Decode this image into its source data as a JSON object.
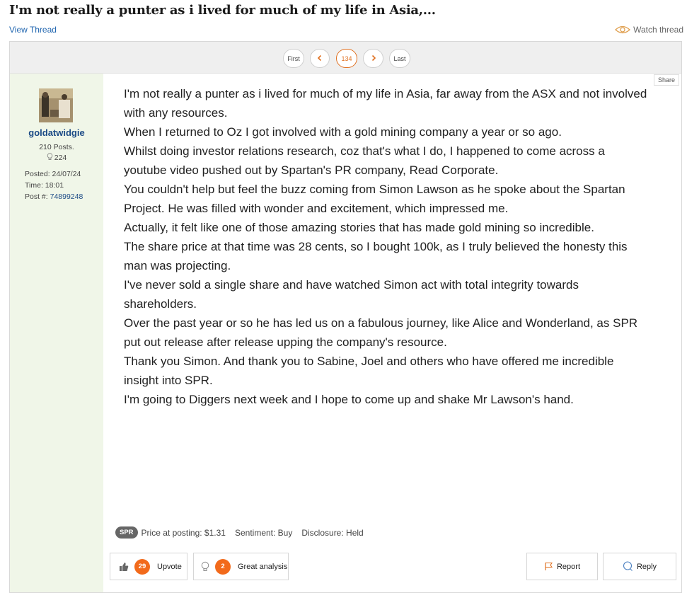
{
  "thread": {
    "title": "I'm not really a punter as i lived for much of my life in Asia,...",
    "view_thread_label": "View Thread",
    "watch_label": "Watch thread"
  },
  "pager": {
    "first": "First",
    "current": "134",
    "last": "Last"
  },
  "author": {
    "username": "goldatwidgie",
    "posts": "210 Posts.",
    "likes": "224",
    "posted": "Posted: 24/07/24",
    "time": "Time: 18:01",
    "post_label": "Post #:",
    "post_number": "74899248"
  },
  "share_label": "Share",
  "post": {
    "lines": [
      "I'm not really a punter as i lived for much of my life in Asia, far away from the ASX and not involved with any resources.",
      "When I returned to Oz I got involved with a gold mining company a year or so ago.",
      "Whilst doing investor relations research, coz that's what I do, I happened to come across a youtube video pushed out by Spartan's PR company, Read Corporate.",
      "You couldn't help but feel the buzz coming from Simon Lawson as he spoke about the Spartan Project. He was filled with wonder and excitement, which impressed me.",
      "Actually, it felt like one of those amazing stories that has made gold mining so incredible.",
      "The share price at that time was 28 cents, so I bought 100k, as I truly believed the honesty this man was projecting.",
      "I've never sold a single share and have watched Simon act with total integrity towards shareholders.",
      "Over the past year or so he has led us on a fabulous journey, like Alice and Wonderland, as SPR put out release after release upping the company's resource.",
      "Thank you Simon. And thank you to Sabine, Joel and others who have offered me incredible insight into SPR.",
      "I'm going to Diggers next week and I hope to come up and shake Mr Lawson's hand."
    ]
  },
  "disclosure": {
    "ticker": "SPR",
    "price": "Price at posting: $1.31",
    "sentiment": "Sentiment: Buy",
    "disclosure": "Disclosure: Held"
  },
  "actions": {
    "upvote_count": "29",
    "upvote_label": "Upvote",
    "great_count": "2",
    "great_label": "Great analysis",
    "report_label": "Report",
    "reply_label": "Reply"
  },
  "icons": {
    "watch": "eye-icon",
    "prev": "chevron-left-icon",
    "next": "chevron-right-icon",
    "likes": "lightbulb-icon",
    "upvote": "thumbs-up-icon",
    "great": "lightbulb-icon",
    "report": "flag-icon",
    "reply": "speech-bubble-icon"
  },
  "colors": {
    "accent": "#f26a1b",
    "link": "#1c4b86",
    "sidebar": "#f0f6e8"
  }
}
